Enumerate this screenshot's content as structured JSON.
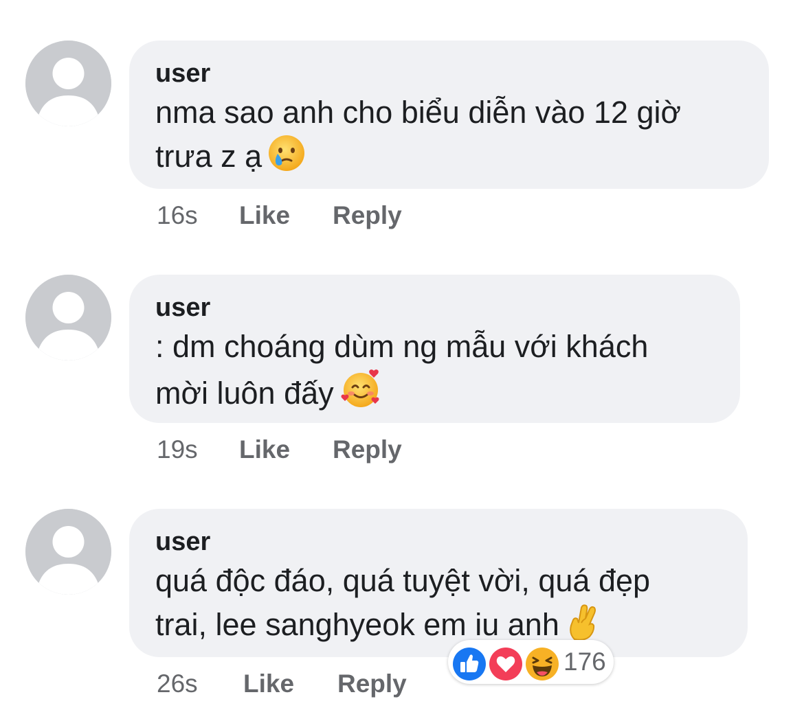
{
  "comments": [
    {
      "username": "user",
      "line1": "nma sao anh cho biểu diễn vào 12 giờ",
      "line2": "trưa z ạ",
      "emoji": "crying-face-emoji",
      "time": "16s",
      "like_label": "Like",
      "reply_label": "Reply"
    },
    {
      "username": "user",
      "line1": ": dm choáng dùm ng mẫu với khách",
      "line2": "mời luôn đấy",
      "emoji": "smiling-face-with-hearts-emoji",
      "time": "19s",
      "like_label": "Like",
      "reply_label": "Reply"
    },
    {
      "username": "user",
      "line1": "quá độc đáo, quá tuyệt vời, quá đẹp",
      "line2": "trai, lee sanghyeok em iu anh",
      "emoji": "crossed-fingers-emoji",
      "time": "26s",
      "like_label": "Like",
      "reply_label": "Reply",
      "reactions": {
        "icons": [
          "like-reaction-icon",
          "love-reaction-icon",
          "haha-reaction-icon"
        ],
        "count": "176"
      }
    }
  ],
  "colors": {
    "bubble": "#f0f1f4",
    "text": "#1c1e21",
    "meta": "#65676b",
    "avatar": "#c9cbcf",
    "like_blue": "#1877f2",
    "love_red": "#f33e58",
    "haha_yellow": "#f7b125"
  }
}
